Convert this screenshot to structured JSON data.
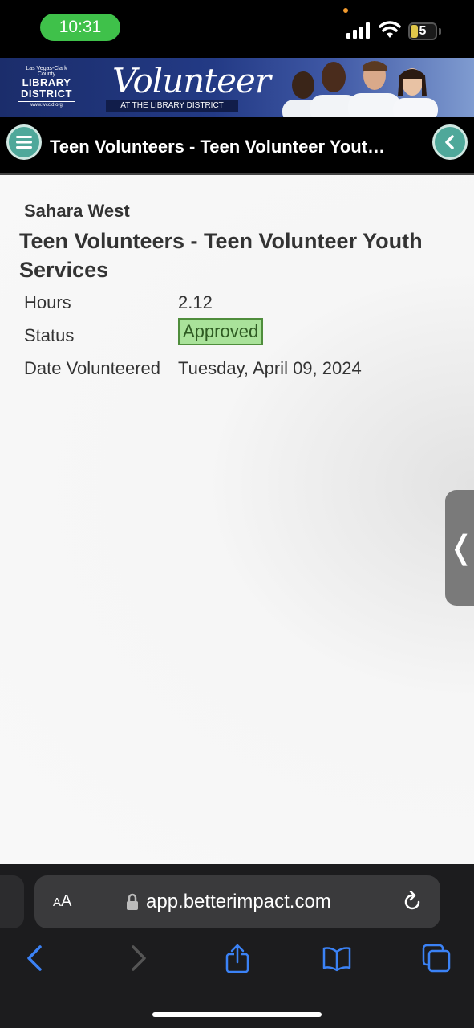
{
  "status_bar": {
    "time": "10:31",
    "battery_level": "5"
  },
  "banner": {
    "library": {
      "county": "Las Vegas-Clark County",
      "line1": "LIBRARY",
      "line2": "DISTRICT",
      "url": "www.lvccld.org"
    },
    "volunteer_word": "Volunteer",
    "volunteer_sub": "AT THE LIBRARY DISTRICT"
  },
  "nav": {
    "title": "Teen Volunteers - Teen Volunteer Yout…",
    "menu_icon": "menu-icon",
    "back_icon": "chevron-left-icon",
    "accent": "#4fa89a"
  },
  "record": {
    "location": "Sahara West",
    "title": "Teen Volunteers - Teen Volunteer Youth Services",
    "hours_label": "Hours",
    "hours_value": "2.12",
    "status_label": "Status",
    "status_value": "Approved",
    "date_label": "Date Volunteered",
    "date_value": "Tuesday, April 09, 2024",
    "status_color": "#a9e29a"
  },
  "side_tab": {
    "glyph": "❬"
  },
  "browser": {
    "aa_big": "A",
    "aa_small": "A",
    "url": "app.betterimpact.com"
  }
}
